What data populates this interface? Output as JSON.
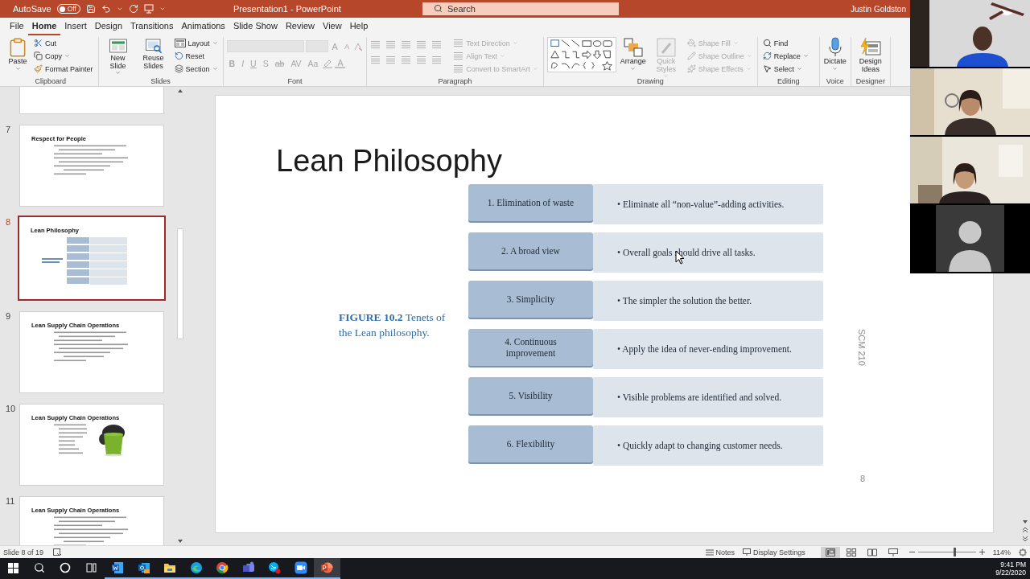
{
  "titlebar": {
    "autosave": {
      "label": "AutoSave",
      "on": false,
      "state_text": "Off"
    },
    "title": "Presentation1  -  PowerPoint",
    "search": {
      "placeholder": "Search"
    },
    "user": "Justin Goldston"
  },
  "ribbon_tabs": [
    {
      "label": "File",
      "selected": false
    },
    {
      "label": "Home",
      "selected": true
    },
    {
      "label": "Insert",
      "selected": false
    },
    {
      "label": "Design",
      "selected": false
    },
    {
      "label": "Transitions",
      "selected": false
    },
    {
      "label": "Animations",
      "selected": false
    },
    {
      "label": "Slide Show",
      "selected": false
    },
    {
      "label": "Review",
      "selected": false
    },
    {
      "label": "View",
      "selected": false
    },
    {
      "label": "Help",
      "selected": false
    }
  ],
  "ribbon_groups": [
    {
      "label": "Clipboard",
      "kind": "buttons",
      "large": [
        {
          "label": "Paste",
          "disabled": false,
          "menu": true
        }
      ],
      "small": [
        {
          "label": "Cut",
          "disabled": false,
          "menu": false
        },
        {
          "label": "Copy",
          "disabled": false,
          "menu": true
        },
        {
          "label": "Format Painter",
          "disabled": false,
          "menu": false
        }
      ]
    },
    {
      "label": "Slides",
      "kind": "buttons",
      "large": [
        {
          "label": "New Slide",
          "disabled": false,
          "menu": true
        },
        {
          "label": "Reuse Slides",
          "disabled": false,
          "menu": false
        }
      ],
      "small": [
        {
          "label": "Layout",
          "disabled": false,
          "menu": true
        },
        {
          "label": "Reset",
          "disabled": false,
          "menu": false
        },
        {
          "label": "Section",
          "disabled": false,
          "menu": true
        }
      ]
    },
    {
      "label": "Font",
      "kind": "font",
      "disabled": true,
      "size_glyphs": [
        "A",
        "A"
      ],
      "format_glyphs": [
        "B",
        "I",
        "U",
        "S",
        "ab",
        "AV",
        "Aa"
      ],
      "color_glyph": "A"
    },
    {
      "label": "Paragraph",
      "kind": "paragraph",
      "small": [
        {
          "label": "Text Direction",
          "disabled": true,
          "menu": true
        },
        {
          "label": "Align Text",
          "disabled": true,
          "menu": true
        },
        {
          "label": "Convert to SmartArt",
          "disabled": true,
          "menu": true
        }
      ]
    },
    {
      "label": "Drawing",
      "kind": "drawing",
      "large": [
        {
          "label": "Arrange",
          "disabled": false,
          "menu": true
        },
        {
          "label": "Quick Styles",
          "disabled": true,
          "menu": true
        }
      ],
      "small": [
        {
          "label": "Shape Fill",
          "disabled": true,
          "menu": true
        },
        {
          "label": "Shape Outline",
          "disabled": true,
          "menu": true
        },
        {
          "label": "Shape Effects",
          "disabled": true,
          "menu": true
        }
      ]
    },
    {
      "label": "Editing",
      "kind": "buttons",
      "small": [
        {
          "label": "Find",
          "disabled": false,
          "menu": false
        },
        {
          "label": "Replace",
          "disabled": false,
          "menu": true
        },
        {
          "label": "Select",
          "disabled": false,
          "menu": true
        }
      ]
    },
    {
      "label": "Voice",
      "kind": "buttons",
      "large": [
        {
          "label": "Dictate",
          "disabled": false,
          "menu": true
        }
      ]
    },
    {
      "label": "Designer",
      "kind": "buttons",
      "large": [
        {
          "label": "Design Ideas",
          "disabled": false,
          "menu": false
        }
      ]
    }
  ],
  "slides_pane": {
    "slides": [
      {
        "kind": "blank",
        "selected": false
      },
      {
        "number": "7",
        "title": "Respect for People",
        "kind": "bullets",
        "selected": false
      },
      {
        "number": "8",
        "title": "Lean Philosophy",
        "kind": "diagram",
        "selected": true
      },
      {
        "number": "9",
        "title": "Lean Supply Chain Operations",
        "kind": "bullets",
        "selected": false
      },
      {
        "number": "10",
        "title": "Lean Supply Chain Operations",
        "kind": "picture",
        "selected": false
      },
      {
        "number": "11",
        "title": "Lean Supply Chain Operations",
        "kind": "bullets",
        "selected": false
      }
    ]
  },
  "slide": {
    "title": "Lean Philosophy",
    "caption": "**FIGURE 10.2**  Tenets of the Lean philosophy.",
    "tenets": [
      {
        "label": "1. Elimination of waste",
        "description": "• Eliminate all “non-value”-adding activities."
      },
      {
        "label": "2. A broad view",
        "description": "• Overall goals should drive all tasks."
      },
      {
        "label": "3. Simplicity",
        "description": "• The simpler the solution the better."
      },
      {
        "label": "4. Continuous improvement",
        "description": "• Apply the idea of never-ending improvement."
      },
      {
        "label": "5. Visibility",
        "description": "• Visible problems are identified and solved."
      },
      {
        "label": "6. Flexibility",
        "description": "• Quickly adapt to changing customer needs."
      }
    ],
    "footer": "SCM 210",
    "page_number": "8"
  },
  "video_call": {
    "tiles": [
      {
        "kind": "picture"
      },
      {
        "kind": "picture"
      },
      {
        "kind": "picture"
      },
      {
        "kind": "avatar"
      }
    ]
  },
  "status_bar": {
    "slide_indicator": "Slide 8 of 19",
    "notes": "Notes",
    "display_settings": "Display Settings",
    "views": [
      {
        "selected": true
      },
      {
        "selected": false
      },
      {
        "selected": false
      },
      {
        "selected": false
      }
    ],
    "zoom": {
      "level": 0.62,
      "reading": "114%"
    }
  },
  "taskbar": {
    "apps": [
      {
        "open": false,
        "active": false
      },
      {
        "open": false,
        "active": false
      },
      {
        "open": false,
        "active": false
      },
      {
        "open": false,
        "active": false
      },
      {
        "open": true,
        "active": false
      },
      {
        "open": true,
        "active": false
      },
      {
        "open": true,
        "active": false
      },
      {
        "open": true,
        "active": false
      },
      {
        "open": true,
        "active": false
      },
      {
        "open": true,
        "active": false
      },
      {
        "open": true,
        "active": false
      },
      {
        "open": true,
        "active": false
      },
      {
        "open": true,
        "active": true
      }
    ],
    "time": "9:41 PM",
    "date": "9/22/2020"
  }
}
